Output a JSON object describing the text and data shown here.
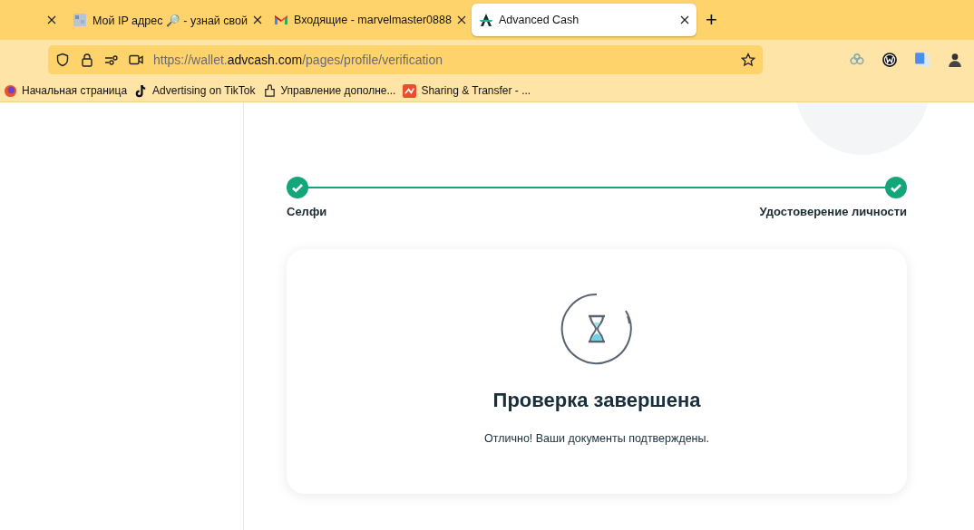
{
  "browser": {
    "tabs": [
      {
        "selected": false
      },
      {
        "title": "Мой IP адрес 🔎 - узнай свой",
        "selected": false
      },
      {
        "title": "Входящие - marvelmaster0888",
        "selected": false
      },
      {
        "title": "Advanced Cash",
        "selected": true
      }
    ],
    "new_tab": "+",
    "url": {
      "prefix": "https://wallet.",
      "domain": "advcash.com",
      "path": "/pages/profile/verification"
    },
    "bookmarks": [
      {
        "label": "Начальная страница"
      },
      {
        "label": "Advertising on TikTok"
      },
      {
        "label": "Управление дополне..."
      },
      {
        "label": "Sharing & Transfer - ..."
      }
    ]
  },
  "steps": [
    {
      "label": "Селфи",
      "done": true
    },
    {
      "label": "Удостоверение личности",
      "done": true
    }
  ],
  "result": {
    "title": "Проверка завершена",
    "message": "Отлично! Ваши документы подтверждены."
  }
}
